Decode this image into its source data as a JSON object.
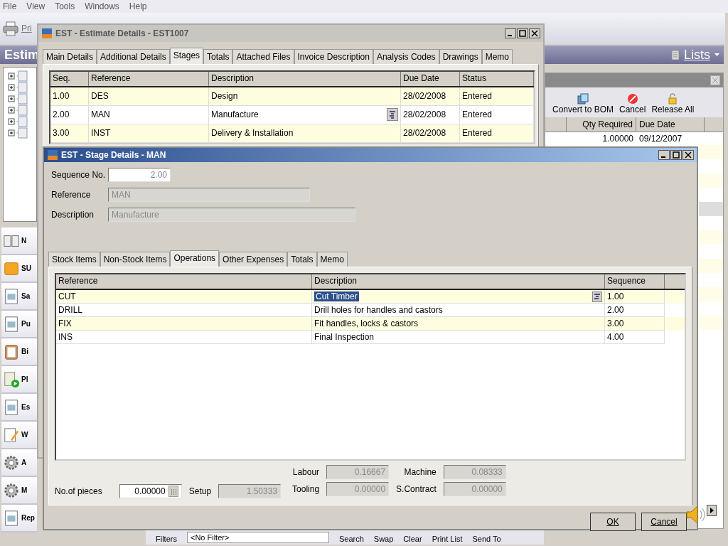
{
  "menu": [
    {
      "label": "File"
    },
    {
      "label": "View"
    },
    {
      "label": "Tools"
    },
    {
      "label": "Windows"
    },
    {
      "label": "Help"
    }
  ],
  "toolbar": {
    "print_label": "Pri"
  },
  "module_header": {
    "title": "Estim",
    "lists_label": "Lists"
  },
  "nav_items": [
    {
      "label": "N",
      "kind": "book"
    },
    {
      "label": "SU",
      "kind": "box"
    },
    {
      "label": "Sa",
      "kind": "sheet"
    },
    {
      "label": "Pu",
      "kind": "sheet"
    },
    {
      "label": "Bi",
      "kind": "clipboard"
    },
    {
      "label": "Pl",
      "kind": "play"
    },
    {
      "label": "Es",
      "kind": "sheet"
    },
    {
      "label": "W",
      "kind": "pencil"
    },
    {
      "label": "A",
      "kind": "gear"
    },
    {
      "label": "M",
      "kind": "gear"
    },
    {
      "label": "Rep",
      "kind": "sheet"
    }
  ],
  "background_panel": {
    "actions": [
      {
        "label": "Convert to BOM",
        "kind": "convert"
      },
      {
        "label": "Cancel",
        "kind": "cancel"
      },
      {
        "label": "Release All",
        "kind": "lock"
      }
    ],
    "columns": [
      "Qty Required",
      "Due Date"
    ],
    "rows": [
      [
        "1.00000",
        "09/12/2007"
      ]
    ]
  },
  "filter_bar": {
    "label": "Filters",
    "value": "<No Filter>",
    "actions": [
      "Search",
      "Swap",
      "Clear",
      "Print List",
      "Send To"
    ]
  },
  "estimate_window": {
    "title": "EST - Estimate Details - EST1007",
    "tabs": [
      {
        "label": "Main Details",
        "selected": false
      },
      {
        "label": "Additional Details",
        "selected": false
      },
      {
        "label": "Stages",
        "selected": true
      },
      {
        "label": "Totals",
        "selected": false
      },
      {
        "label": "Attached Files",
        "selected": false
      },
      {
        "label": "Invoice Description",
        "selected": false
      },
      {
        "label": "Analysis Codes",
        "selected": false
      },
      {
        "label": "Drawings",
        "selected": false
      },
      {
        "label": "Memo",
        "selected": false
      }
    ],
    "columns": [
      "Seq.",
      "Reference",
      "Description",
      "Due Date",
      "Status"
    ],
    "rows": [
      {
        "cells": [
          "1.00",
          "DES",
          "Design",
          "28/02/2008",
          "Entered"
        ],
        "editing": false
      },
      {
        "cells": [
          "2.00",
          "MAN",
          "Manufacture",
          "28/02/2008",
          "Entered"
        ],
        "editing": true
      },
      {
        "cells": [
          "3.00",
          "INST",
          "Delivery & Installation",
          "28/02/2008",
          "Entered"
        ],
        "editing": false
      }
    ]
  },
  "stage_window": {
    "title": "EST - Stage Details - MAN",
    "fields": [
      {
        "label": "Sequence No.",
        "value": "2.00",
        "disabled": false
      },
      {
        "label": "Reference",
        "value": "MAN",
        "disabled": true
      },
      {
        "label": "Description",
        "value": "Manufacture",
        "disabled": true
      }
    ],
    "tabs": [
      {
        "label": "Stock Items",
        "selected": false
      },
      {
        "label": "Non-Stock Items",
        "selected": false
      },
      {
        "label": "Operations",
        "selected": true
      },
      {
        "label": "Other Expenses",
        "selected": false
      },
      {
        "label": "Totals",
        "selected": false
      },
      {
        "label": "Memo",
        "selected": false
      }
    ],
    "columns": [
      "Reference",
      "Description",
      "Sequence"
    ],
    "rows": [
      {
        "reference": "CUT",
        "description": "Cut Timber",
        "sequence": "1.00",
        "selected": true
      },
      {
        "reference": "DRILL",
        "description": "Drill holes for handles and castors",
        "sequence": "2.00",
        "selected": false
      },
      {
        "reference": "FIX",
        "description": "Fit handles, locks & castors",
        "sequence": "3.00",
        "selected": false
      },
      {
        "reference": "INS",
        "description": "Final Inspection",
        "sequence": "4.00",
        "selected": false
      }
    ],
    "pieces": {
      "label": "No.of pieces",
      "value": "0.00000"
    },
    "setup": {
      "label": "Setup",
      "value": "1.50333"
    },
    "costs": [
      {
        "label": "Labour",
        "value": "0.16667"
      },
      {
        "label": "Machine",
        "value": "0.08333"
      },
      {
        "label": "Tooling",
        "value": "0.00000"
      },
      {
        "label": "S.Contract",
        "value": "0.00000"
      }
    ],
    "buttons": [
      {
        "label": "OK"
      },
      {
        "label": "Cancel"
      }
    ]
  }
}
